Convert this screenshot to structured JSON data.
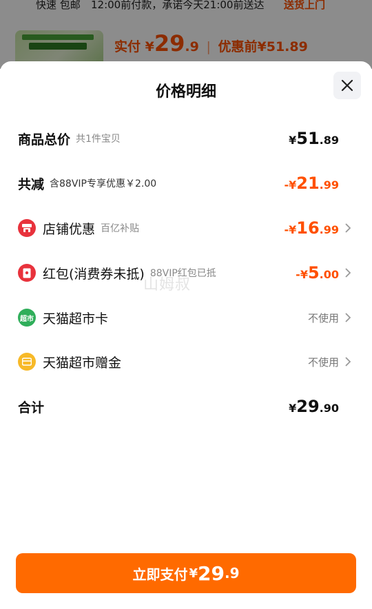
{
  "background": {
    "delivery": {
      "shipping": "快速 包邮",
      "notice": "12:00前付款，承诺今天21:00前送达",
      "door": "送货上门"
    },
    "product": {
      "paid_label": "实付",
      "currency": "¥",
      "paid_int": "29",
      "paid_dec": ".9",
      "separator": "|",
      "before_discount": "优惠前¥51.89"
    }
  },
  "sheet": {
    "title": "价格明细",
    "close_icon": "close-icon",
    "rows": [
      {
        "label": "商品总价",
        "sub": "共1件宝贝",
        "currency": "¥",
        "int": "51",
        "dec": ".89"
      },
      {
        "label": "共减",
        "sub": "含88VIP专享优惠￥2.00",
        "currency": "-¥",
        "int": "21",
        "dec": ".99"
      },
      {
        "label": "店铺优惠",
        "sub": "百亿补贴",
        "currency": "-¥",
        "int": "16",
        "dec": ".99",
        "icon": "shop-icon"
      },
      {
        "label": "红包(消费券未抵)",
        "sub": "88VIP红包已抵",
        "currency": "-¥",
        "int": "5",
        "dec": ".00",
        "icon": "red-packet-icon"
      },
      {
        "label": "天猫超市卡",
        "value": "不使用",
        "icon": "supermarket-card-icon",
        "icon_text": "超市"
      },
      {
        "label": "天猫超市赠金",
        "value": "不使用",
        "icon": "gift-money-icon"
      },
      {
        "label": "合计",
        "currency": "¥",
        "int": "29",
        "dec": ".90"
      }
    ],
    "watermark": "山姆叔"
  },
  "pay_button": {
    "label": "立即支付",
    "currency": "¥",
    "int": "29",
    "dec": ".9"
  },
  "colors": {
    "accent": "#ff5000",
    "button": "#ff6a00",
    "shop_icon": "#e8323c",
    "card_icon": "#2fae5a",
    "gift_icon": "#f7b928"
  }
}
